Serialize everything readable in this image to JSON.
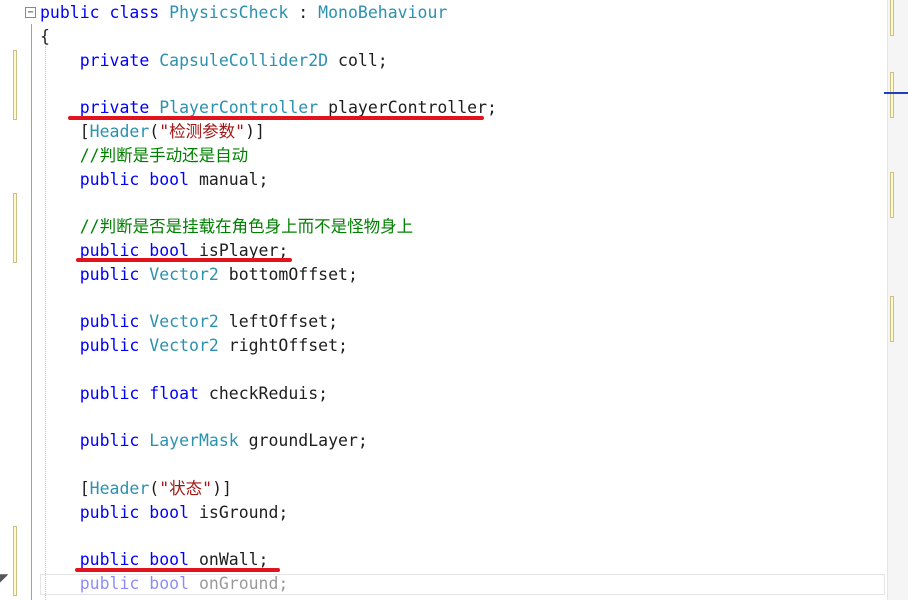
{
  "editor": {
    "collapse_symbol": "−",
    "lines": [
      [
        {
          "t": "public class ",
          "c": "kw"
        },
        {
          "t": "PhysicsCheck",
          "c": "ty"
        },
        {
          "t": " : ",
          "c": "pl"
        },
        {
          "t": "MonoBehaviour",
          "c": "ty"
        }
      ],
      [
        {
          "t": "{",
          "c": "pl"
        }
      ],
      [
        {
          "t": "    private ",
          "c": "kw"
        },
        {
          "t": "CapsuleCollider2D",
          "c": "ty"
        },
        {
          "t": " coll;",
          "c": "pl"
        }
      ],
      [],
      [
        {
          "t": "    private ",
          "c": "kw"
        },
        {
          "t": "PlayerController",
          "c": "ty"
        },
        {
          "t": " playerController;",
          "c": "pl"
        }
      ],
      [
        {
          "t": "    [",
          "c": "pl"
        },
        {
          "t": "Header",
          "c": "ty"
        },
        {
          "t": "(",
          "c": "pl"
        },
        {
          "t": "\"检测参数\"",
          "c": "str"
        },
        {
          "t": ")]",
          "c": "pl"
        }
      ],
      [
        {
          "t": "    //判断是手动还是自动",
          "c": "cm"
        }
      ],
      [
        {
          "t": "    public bool ",
          "c": "kw"
        },
        {
          "t": "manual;",
          "c": "pl"
        }
      ],
      [],
      [
        {
          "t": "    //判断是否是挂载在角色身上而不是怪物身上",
          "c": "cm"
        }
      ],
      [
        {
          "t": "    public bool ",
          "c": "kw"
        },
        {
          "t": "isPlayer;",
          "c": "pl"
        }
      ],
      [
        {
          "t": "    public ",
          "c": "kw"
        },
        {
          "t": "Vector2",
          "c": "ty"
        },
        {
          "t": " bottomOffset;",
          "c": "pl"
        }
      ],
      [],
      [
        {
          "t": "    public ",
          "c": "kw"
        },
        {
          "t": "Vector2",
          "c": "ty"
        },
        {
          "t": " leftOffset;",
          "c": "pl"
        }
      ],
      [
        {
          "t": "    public ",
          "c": "kw"
        },
        {
          "t": "Vector2",
          "c": "ty"
        },
        {
          "t": " rightOffset;",
          "c": "pl"
        }
      ],
      [],
      [
        {
          "t": "    public float ",
          "c": "kw"
        },
        {
          "t": "checkReduis;",
          "c": "pl"
        }
      ],
      [],
      [
        {
          "t": "    public ",
          "c": "kw"
        },
        {
          "t": "LayerMask",
          "c": "ty"
        },
        {
          "t": " groundLayer;",
          "c": "pl"
        }
      ],
      [],
      [
        {
          "t": "    [",
          "c": "pl"
        },
        {
          "t": "Header",
          "c": "ty"
        },
        {
          "t": "(",
          "c": "pl"
        },
        {
          "t": "\"状态\"",
          "c": "str"
        },
        {
          "t": ")]",
          "c": "pl"
        }
      ],
      [
        {
          "t": "    public bool ",
          "c": "kw"
        },
        {
          "t": "isGround;",
          "c": "pl"
        }
      ],
      [],
      [
        {
          "t": "    public bool ",
          "c": "kw"
        },
        {
          "t": "onWall;",
          "c": "pl"
        }
      ],
      [
        {
          "t": "    public bool ",
          "c": "kw"
        },
        {
          "t": "onGround;",
          "c": "pl"
        }
      ]
    ]
  },
  "annotation_color": "#e1141e"
}
